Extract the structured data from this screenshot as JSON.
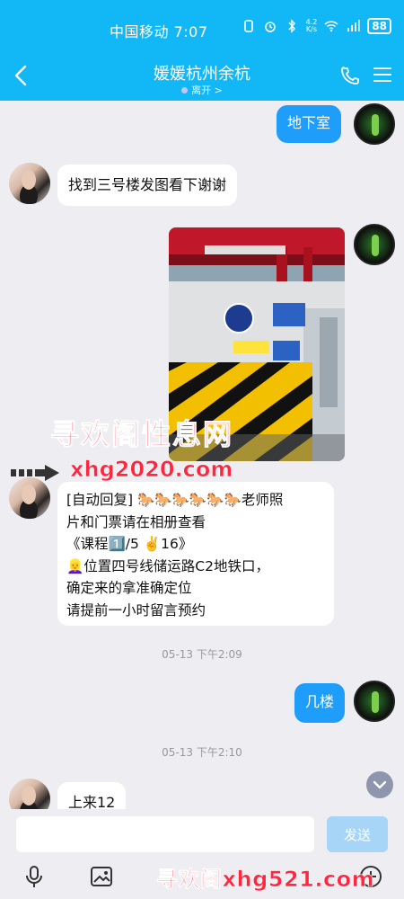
{
  "status_bar": {
    "carrier_time": "中国移动 7:07",
    "net_speed_top": "4.2",
    "net_speed_bottom": "K/s",
    "battery": "88"
  },
  "header": {
    "title": "媛媛杭州余杭",
    "status": "离开 >"
  },
  "messages": [
    {
      "side": "out",
      "text": "地下室"
    },
    {
      "side": "in",
      "text": "找到三号楼发图看下谢谢"
    },
    {
      "side": "out",
      "type": "image"
    },
    {
      "side": "in",
      "lines": [
        "[自动回复] 🐎🐎🐎🐎🐎🐎老师照",
        "片和门票请在相册查看",
        "《课程1️⃣/5 ✌️16》",
        "👱‍♀️位置四号线储运路C2地铁口，",
        "确定来的拿准确定位",
        "请提前一小时留言预约"
      ]
    },
    {
      "side": "out",
      "text": "几楼"
    },
    {
      "side": "in",
      "text": "上来12"
    }
  ],
  "timestamps": [
    "05-13 下午2:09",
    "05-13 下午2:10"
  ],
  "watermarks": {
    "top": "寻欢阁性息网",
    "mid": "xhg2020.com",
    "bottom": "寻欢阁xhg521.com"
  },
  "input": {
    "value": "",
    "send_label": "发送"
  },
  "colors": {
    "header": "#12b7f5",
    "out_bubble": "#1e9dfb",
    "watermark": "#ff2740"
  }
}
